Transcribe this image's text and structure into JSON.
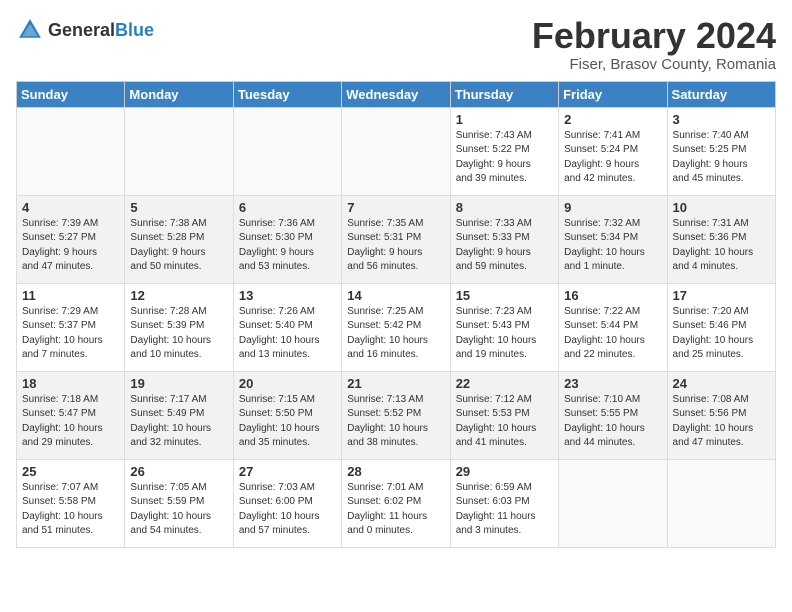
{
  "header": {
    "logo_general": "General",
    "logo_blue": "Blue",
    "month_title": "February 2024",
    "location": "Fiser, Brasov County, Romania"
  },
  "days_of_week": [
    "Sunday",
    "Monday",
    "Tuesday",
    "Wednesday",
    "Thursday",
    "Friday",
    "Saturday"
  ],
  "weeks": [
    [
      {
        "day": "",
        "detail": ""
      },
      {
        "day": "",
        "detail": ""
      },
      {
        "day": "",
        "detail": ""
      },
      {
        "day": "",
        "detail": ""
      },
      {
        "day": "1",
        "detail": "Sunrise: 7:43 AM\nSunset: 5:22 PM\nDaylight: 9 hours\nand 39 minutes."
      },
      {
        "day": "2",
        "detail": "Sunrise: 7:41 AM\nSunset: 5:24 PM\nDaylight: 9 hours\nand 42 minutes."
      },
      {
        "day": "3",
        "detail": "Sunrise: 7:40 AM\nSunset: 5:25 PM\nDaylight: 9 hours\nand 45 minutes."
      }
    ],
    [
      {
        "day": "4",
        "detail": "Sunrise: 7:39 AM\nSunset: 5:27 PM\nDaylight: 9 hours\nand 47 minutes."
      },
      {
        "day": "5",
        "detail": "Sunrise: 7:38 AM\nSunset: 5:28 PM\nDaylight: 9 hours\nand 50 minutes."
      },
      {
        "day": "6",
        "detail": "Sunrise: 7:36 AM\nSunset: 5:30 PM\nDaylight: 9 hours\nand 53 minutes."
      },
      {
        "day": "7",
        "detail": "Sunrise: 7:35 AM\nSunset: 5:31 PM\nDaylight: 9 hours\nand 56 minutes."
      },
      {
        "day": "8",
        "detail": "Sunrise: 7:33 AM\nSunset: 5:33 PM\nDaylight: 9 hours\nand 59 minutes."
      },
      {
        "day": "9",
        "detail": "Sunrise: 7:32 AM\nSunset: 5:34 PM\nDaylight: 10 hours\nand 1 minute."
      },
      {
        "day": "10",
        "detail": "Sunrise: 7:31 AM\nSunset: 5:36 PM\nDaylight: 10 hours\nand 4 minutes."
      }
    ],
    [
      {
        "day": "11",
        "detail": "Sunrise: 7:29 AM\nSunset: 5:37 PM\nDaylight: 10 hours\nand 7 minutes."
      },
      {
        "day": "12",
        "detail": "Sunrise: 7:28 AM\nSunset: 5:39 PM\nDaylight: 10 hours\nand 10 minutes."
      },
      {
        "day": "13",
        "detail": "Sunrise: 7:26 AM\nSunset: 5:40 PM\nDaylight: 10 hours\nand 13 minutes."
      },
      {
        "day": "14",
        "detail": "Sunrise: 7:25 AM\nSunset: 5:42 PM\nDaylight: 10 hours\nand 16 minutes."
      },
      {
        "day": "15",
        "detail": "Sunrise: 7:23 AM\nSunset: 5:43 PM\nDaylight: 10 hours\nand 19 minutes."
      },
      {
        "day": "16",
        "detail": "Sunrise: 7:22 AM\nSunset: 5:44 PM\nDaylight: 10 hours\nand 22 minutes."
      },
      {
        "day": "17",
        "detail": "Sunrise: 7:20 AM\nSunset: 5:46 PM\nDaylight: 10 hours\nand 25 minutes."
      }
    ],
    [
      {
        "day": "18",
        "detail": "Sunrise: 7:18 AM\nSunset: 5:47 PM\nDaylight: 10 hours\nand 29 minutes."
      },
      {
        "day": "19",
        "detail": "Sunrise: 7:17 AM\nSunset: 5:49 PM\nDaylight: 10 hours\nand 32 minutes."
      },
      {
        "day": "20",
        "detail": "Sunrise: 7:15 AM\nSunset: 5:50 PM\nDaylight: 10 hours\nand 35 minutes."
      },
      {
        "day": "21",
        "detail": "Sunrise: 7:13 AM\nSunset: 5:52 PM\nDaylight: 10 hours\nand 38 minutes."
      },
      {
        "day": "22",
        "detail": "Sunrise: 7:12 AM\nSunset: 5:53 PM\nDaylight: 10 hours\nand 41 minutes."
      },
      {
        "day": "23",
        "detail": "Sunrise: 7:10 AM\nSunset: 5:55 PM\nDaylight: 10 hours\nand 44 minutes."
      },
      {
        "day": "24",
        "detail": "Sunrise: 7:08 AM\nSunset: 5:56 PM\nDaylight: 10 hours\nand 47 minutes."
      }
    ],
    [
      {
        "day": "25",
        "detail": "Sunrise: 7:07 AM\nSunset: 5:58 PM\nDaylight: 10 hours\nand 51 minutes."
      },
      {
        "day": "26",
        "detail": "Sunrise: 7:05 AM\nSunset: 5:59 PM\nDaylight: 10 hours\nand 54 minutes."
      },
      {
        "day": "27",
        "detail": "Sunrise: 7:03 AM\nSunset: 6:00 PM\nDaylight: 10 hours\nand 57 minutes."
      },
      {
        "day": "28",
        "detail": "Sunrise: 7:01 AM\nSunset: 6:02 PM\nDaylight: 11 hours\nand 0 minutes."
      },
      {
        "day": "29",
        "detail": "Sunrise: 6:59 AM\nSunset: 6:03 PM\nDaylight: 11 hours\nand 3 minutes."
      },
      {
        "day": "",
        "detail": ""
      },
      {
        "day": "",
        "detail": ""
      }
    ]
  ]
}
